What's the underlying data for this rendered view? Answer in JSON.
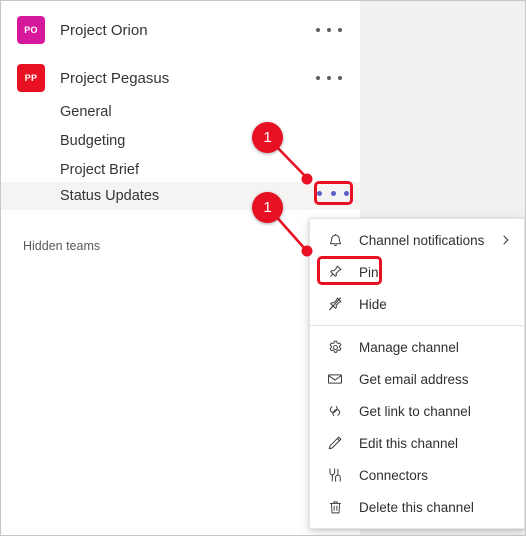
{
  "sidebar": {
    "teams": [
      {
        "name": "Project Orion",
        "initials": "PO",
        "color": "#d6189c",
        "overflow_icon": "ellipsis-icon"
      },
      {
        "name": "Project Pegasus",
        "initials": "PP",
        "color": "#e81123",
        "overflow_icon": "ellipsis-icon"
      }
    ],
    "channels": [
      {
        "name": "General",
        "selected": false
      },
      {
        "name": "Budgeting",
        "selected": false
      },
      {
        "name": "Project Brief",
        "selected": false
      },
      {
        "name": "Status Updates",
        "selected": true
      }
    ],
    "hidden_teams_label": "Hidden teams",
    "channel_more_button": {
      "icon": "ellipsis-icon",
      "dot_color": "#5b5fc7"
    }
  },
  "context_menu": {
    "groups": [
      {
        "items": [
          {
            "label": "Channel notifications",
            "icon": "bell-icon",
            "has_submenu": true,
            "highlighted": false
          },
          {
            "label": "Pin",
            "icon": "pin-icon",
            "has_submenu": false,
            "highlighted": true
          },
          {
            "label": "Hide",
            "icon": "eye-off-icon",
            "has_submenu": false,
            "highlighted": false
          }
        ]
      },
      {
        "items": [
          {
            "label": "Manage channel",
            "icon": "gear-icon",
            "has_submenu": false,
            "highlighted": false
          },
          {
            "label": "Get email address",
            "icon": "envelope-icon",
            "has_submenu": false,
            "highlighted": false
          },
          {
            "label": "Get link to channel",
            "icon": "link-icon",
            "has_submenu": false,
            "highlighted": false
          },
          {
            "label": "Edit this channel",
            "icon": "pencil-icon",
            "has_submenu": false,
            "highlighted": false
          },
          {
            "label": "Connectors",
            "icon": "connectors-icon",
            "has_submenu": false,
            "highlighted": false
          },
          {
            "label": "Delete this channel",
            "icon": "trash-icon",
            "has_submenu": false,
            "highlighted": false
          }
        ]
      }
    ]
  },
  "callouts": [
    {
      "number": "1",
      "target": "channel-more-button"
    },
    {
      "number": "1",
      "target": "pin-menu-item"
    }
  ],
  "colors": {
    "highlight_outline": "#e81123",
    "callout_background": "#e81123",
    "selected_row": "#f5f4f3",
    "content_pane": "#f2f1f0"
  }
}
